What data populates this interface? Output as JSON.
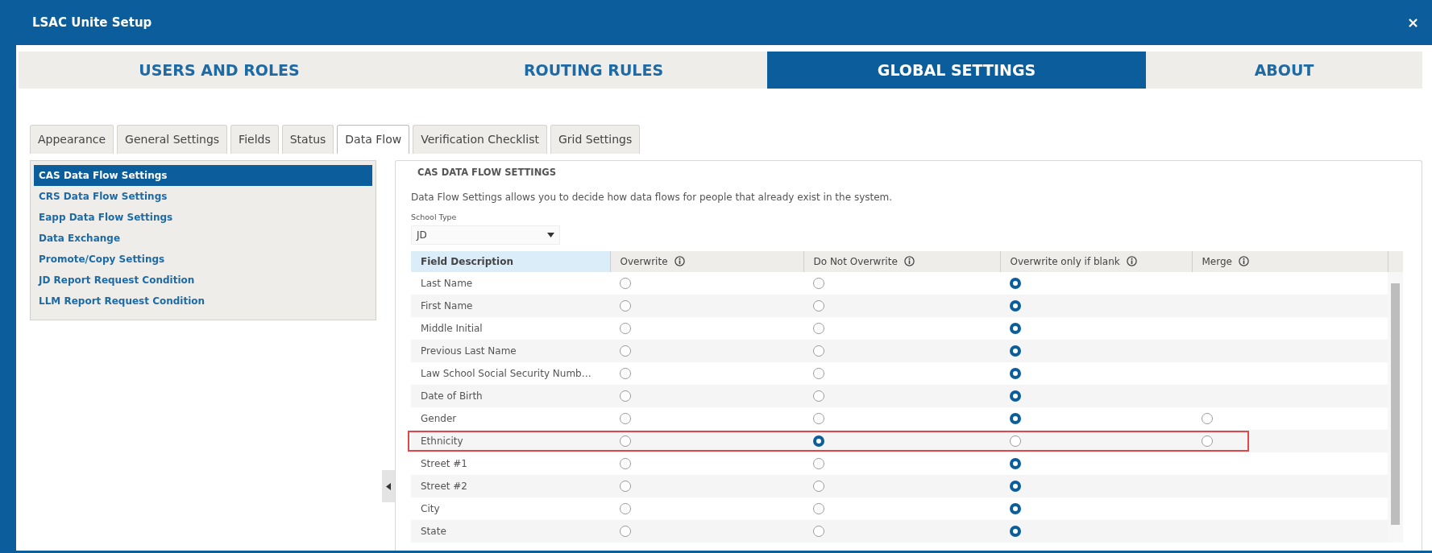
{
  "window": {
    "title": "LSAC Unite Setup",
    "close": "×"
  },
  "top_tabs": [
    {
      "label": "USERS AND ROLES",
      "selected": false
    },
    {
      "label": "ROUTING RULES",
      "selected": false
    },
    {
      "label": "GLOBAL SETTINGS",
      "selected": true
    },
    {
      "label": "ABOUT",
      "selected": false
    }
  ],
  "sub_tabs": [
    {
      "label": "Appearance",
      "selected": false
    },
    {
      "label": "General Settings",
      "selected": false
    },
    {
      "label": "Fields",
      "selected": false
    },
    {
      "label": "Status",
      "selected": false
    },
    {
      "label": "Data Flow",
      "selected": true
    },
    {
      "label": "Verification Checklist",
      "selected": false
    },
    {
      "label": "Grid Settings",
      "selected": false
    }
  ],
  "sidebar": {
    "items": [
      {
        "label": "CAS Data Flow Settings",
        "selected": true
      },
      {
        "label": "CRS Data Flow Settings",
        "selected": false
      },
      {
        "label": "Eapp Data Flow Settings",
        "selected": false
      },
      {
        "label": "Data Exchange",
        "selected": false
      },
      {
        "label": "Promote/Copy Settings",
        "selected": false
      },
      {
        "label": "JD Report Request Condition",
        "selected": false
      },
      {
        "label": "LLM Report Request Condition",
        "selected": false
      }
    ]
  },
  "panel": {
    "legend": "CAS DATA FLOW SETTINGS",
    "description": "Data Flow Settings allows you to decide how data flows for people that already exist in the system.",
    "school_type": {
      "label": "School Type",
      "value": "JD"
    }
  },
  "table": {
    "columns": [
      {
        "label": "Field Description",
        "info": false,
        "sorted": true
      },
      {
        "label": "Overwrite",
        "info": true,
        "sorted": false
      },
      {
        "label": "Do Not Overwrite",
        "info": true,
        "sorted": false
      },
      {
        "label": "Overwrite only if blank",
        "info": true,
        "sorted": false
      },
      {
        "label": "Merge",
        "info": true,
        "sorted": false
      }
    ],
    "rows": [
      {
        "field": "Last Name",
        "highlighted": false,
        "choices": [
          {
            "selected": false
          },
          {
            "selected": false
          },
          {
            "selected": true
          }
        ]
      },
      {
        "field": "First Name",
        "highlighted": false,
        "choices": [
          {
            "selected": false
          },
          {
            "selected": false
          },
          {
            "selected": true
          }
        ]
      },
      {
        "field": "Middle Initial",
        "highlighted": false,
        "choices": [
          {
            "selected": false
          },
          {
            "selected": false
          },
          {
            "selected": true
          }
        ]
      },
      {
        "field": "Previous Last Name",
        "highlighted": false,
        "choices": [
          {
            "selected": false
          },
          {
            "selected": false
          },
          {
            "selected": true
          }
        ]
      },
      {
        "field": "Law School Social Security Numb…",
        "highlighted": false,
        "choices": [
          {
            "selected": false
          },
          {
            "selected": false
          },
          {
            "selected": true
          }
        ]
      },
      {
        "field": "Date of Birth",
        "highlighted": false,
        "choices": [
          {
            "selected": false
          },
          {
            "selected": false
          },
          {
            "selected": true
          }
        ]
      },
      {
        "field": "Gender",
        "highlighted": false,
        "choices": [
          {
            "selected": false
          },
          {
            "selected": false
          },
          {
            "selected": true
          },
          {
            "selected": false
          }
        ]
      },
      {
        "field": "Ethnicity",
        "highlighted": true,
        "choices": [
          {
            "selected": false
          },
          {
            "selected": true
          },
          {
            "selected": false
          },
          {
            "selected": false
          }
        ]
      },
      {
        "field": "Street #1",
        "highlighted": false,
        "choices": [
          {
            "selected": false
          },
          {
            "selected": false
          },
          {
            "selected": true
          }
        ]
      },
      {
        "field": "Street #2",
        "highlighted": false,
        "choices": [
          {
            "selected": false
          },
          {
            "selected": false
          },
          {
            "selected": true
          }
        ]
      },
      {
        "field": "City",
        "highlighted": false,
        "choices": [
          {
            "selected": false
          },
          {
            "selected": false
          },
          {
            "selected": true
          }
        ]
      },
      {
        "field": "State",
        "highlighted": false,
        "choices": [
          {
            "selected": false
          },
          {
            "selected": false
          },
          {
            "selected": true
          }
        ]
      }
    ]
  }
}
